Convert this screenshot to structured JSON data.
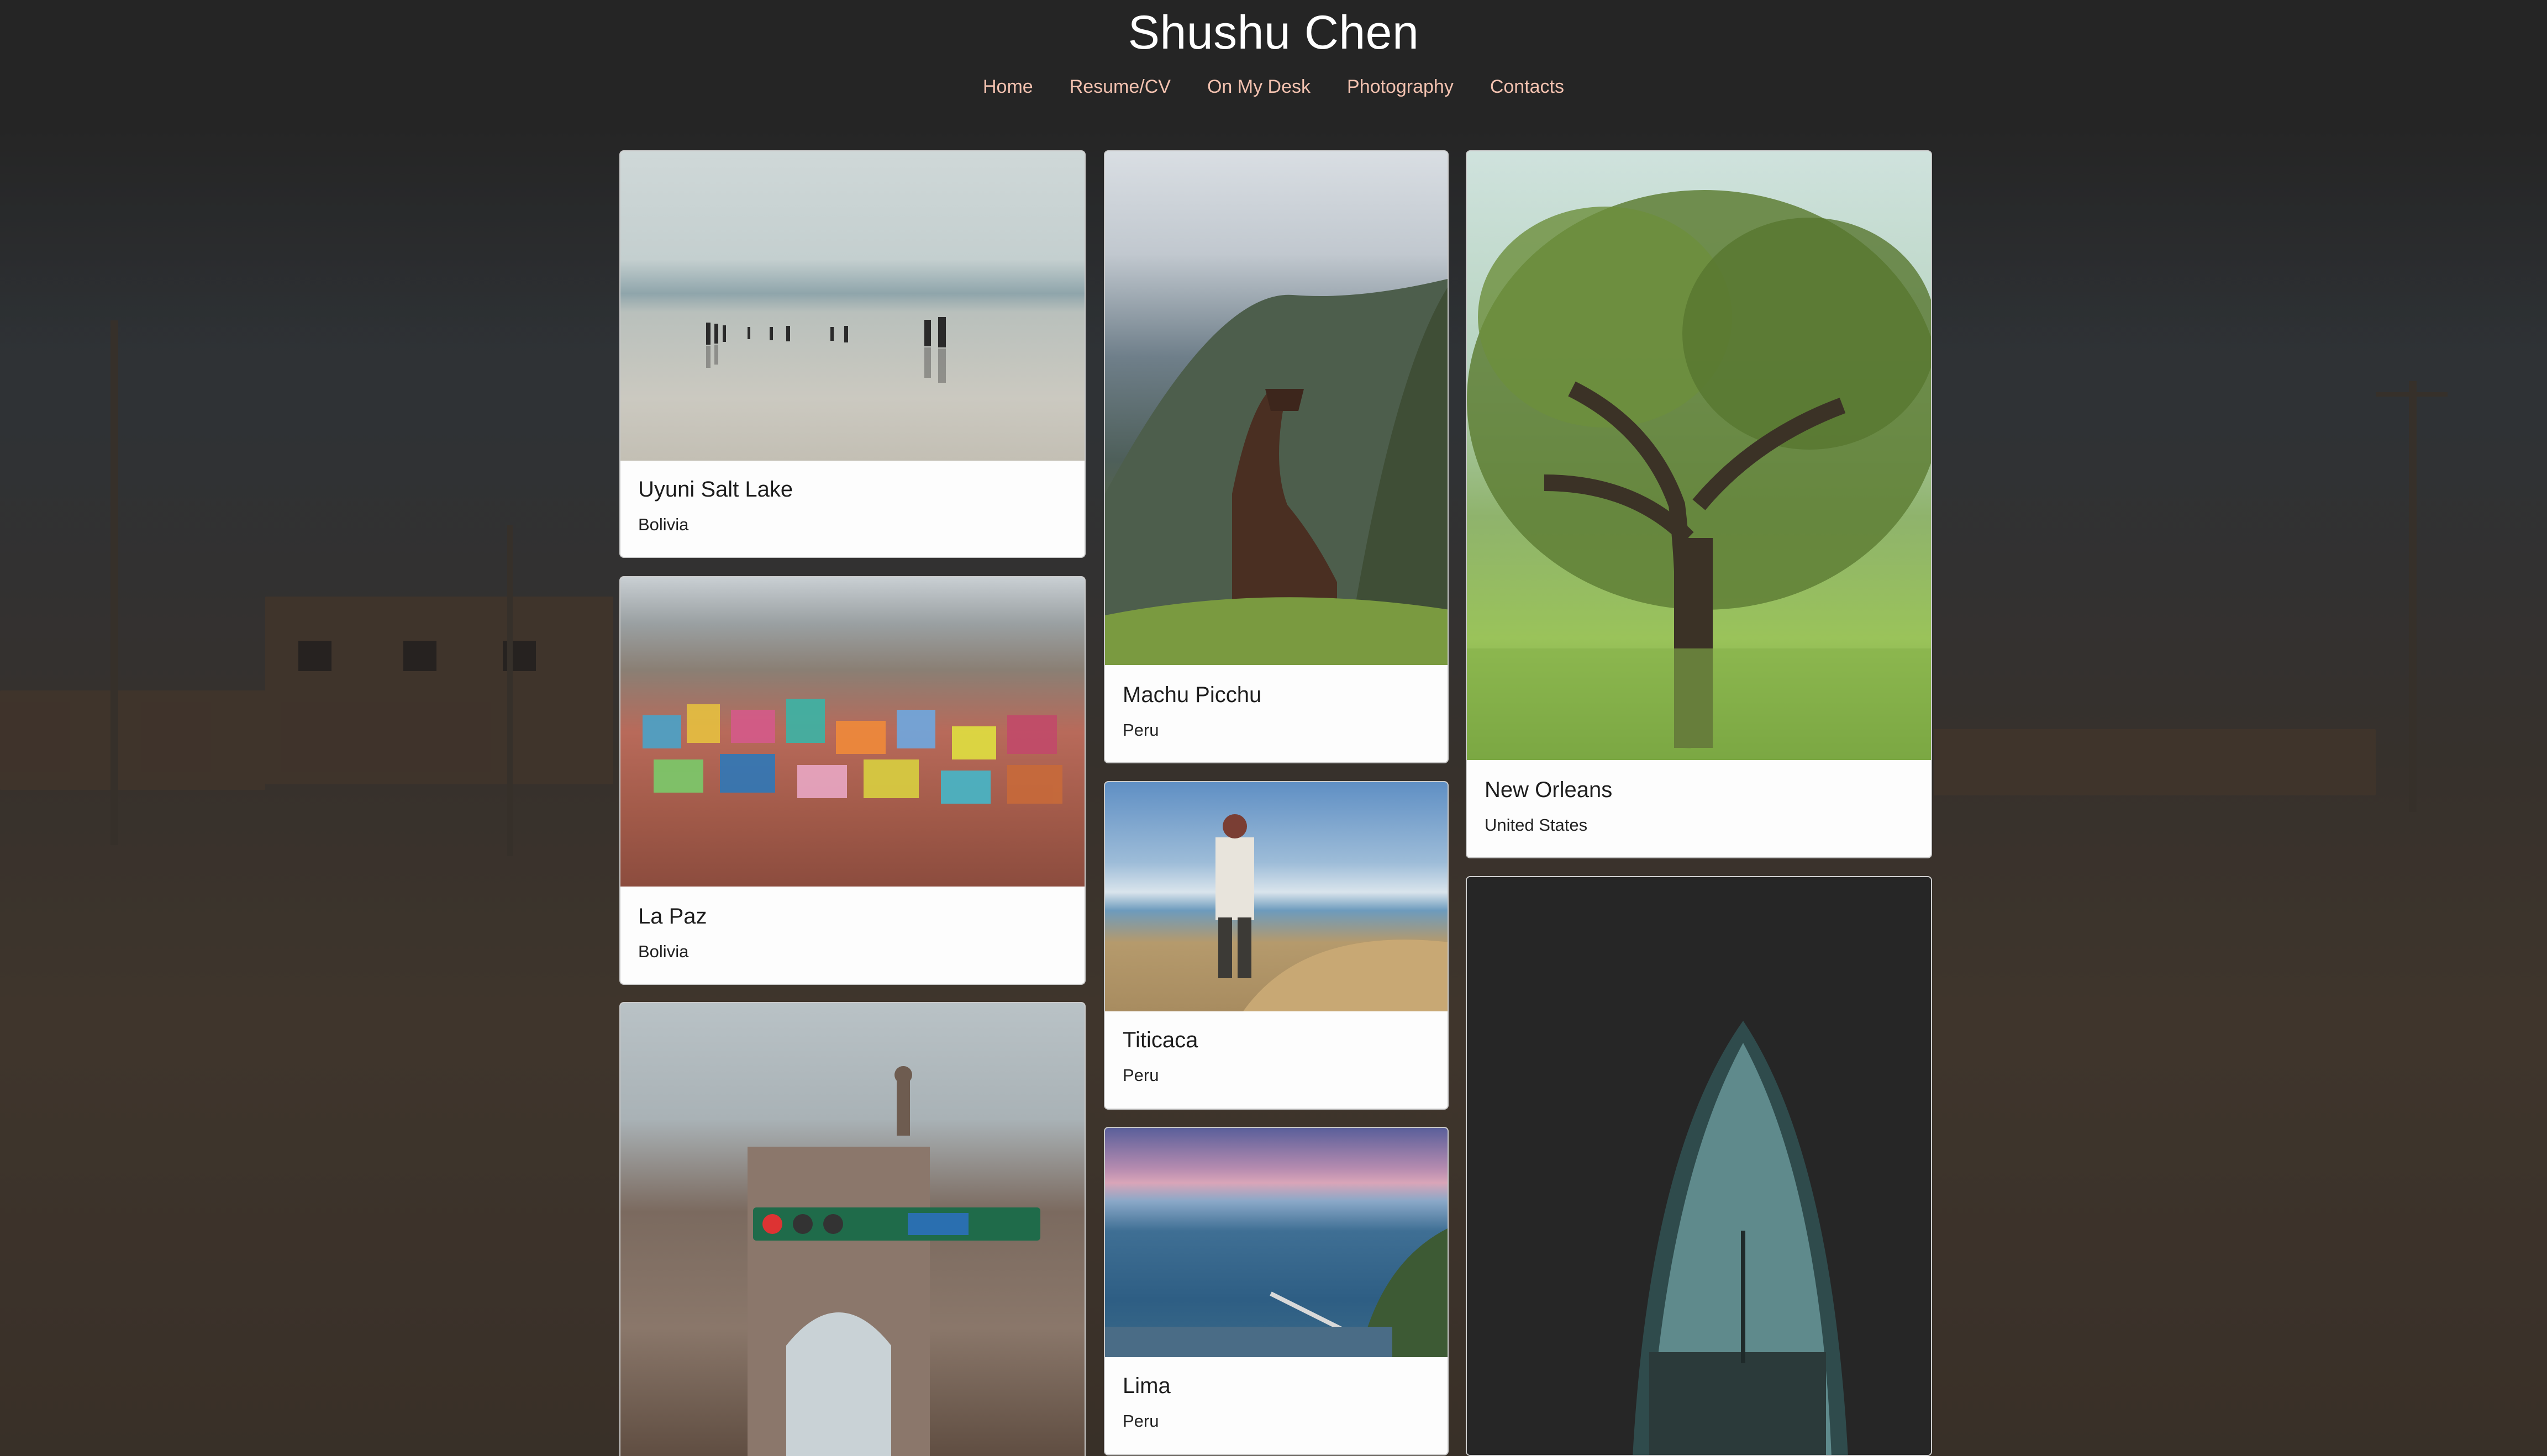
{
  "site": {
    "title": "Shushu Chen"
  },
  "nav": {
    "items": [
      {
        "label": "Home"
      },
      {
        "label": "Resume/CV"
      },
      {
        "label": "On My Desk"
      },
      {
        "label": "Photography"
      },
      {
        "label": "Contacts"
      }
    ]
  },
  "gallery": {
    "cards": [
      {
        "title": "Uyuni Salt Lake",
        "subtitle": "Bolivia"
      },
      {
        "title": "La Paz",
        "subtitle": "Bolivia"
      },
      {
        "title": "Machu Picchu",
        "subtitle": "Peru"
      },
      {
        "title": "Titicaca",
        "subtitle": "Peru"
      },
      {
        "title": "Lima",
        "subtitle": "Peru"
      },
      {
        "title": "New Orleans",
        "subtitle": "United States"
      }
    ]
  },
  "colors": {
    "nav_link": "#f3c2b0",
    "title": "#ffffff",
    "card_bg": "#fdfdfd",
    "page_bg": "#2a2a2a"
  }
}
